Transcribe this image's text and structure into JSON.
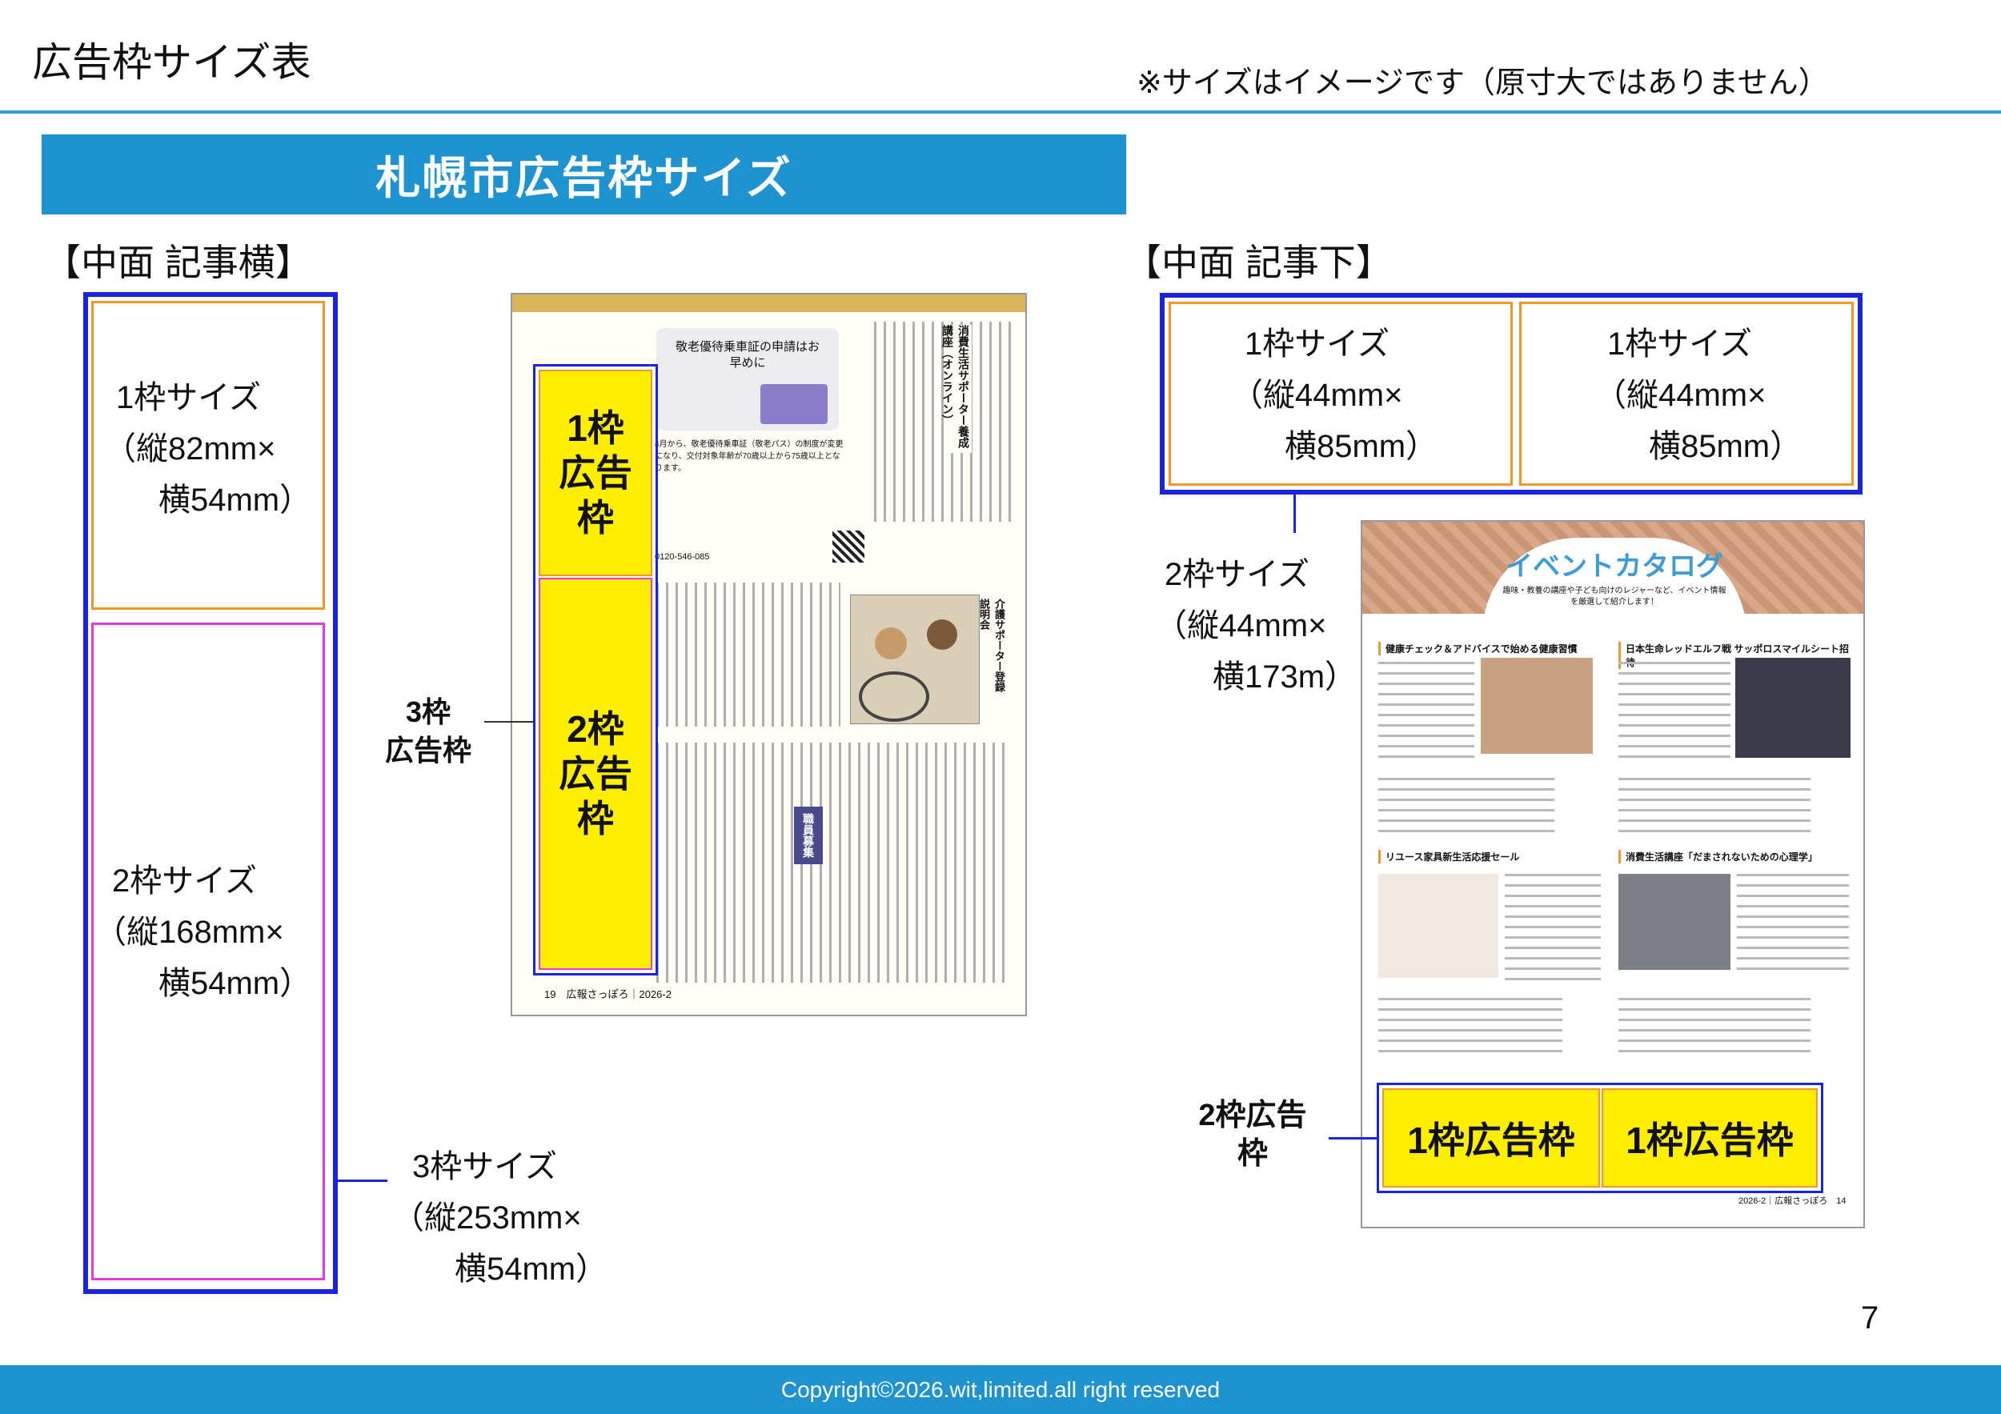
{
  "header": {
    "title": "広告枠サイズ表",
    "note": "※サイズはイメージです（原寸大ではありません）"
  },
  "banner": "札幌市広告枠サイズ",
  "left": {
    "heading": "【中面 記事横】",
    "box1": {
      "l1": "1枠サイズ",
      "l2": "（縦82mm×",
      "l3": "横54mm）"
    },
    "box2": {
      "l1": "2枠サイズ",
      "l2": "（縦168mm×",
      "l3": "横54mm）"
    },
    "box3": {
      "l1": "3枠サイズ",
      "l2": "（縦253mm×",
      "l3": "横54mm）"
    },
    "callout": {
      "l1": "3枠",
      "l2": "広告枠"
    },
    "ad1": {
      "l1": "1枠",
      "l2": "広告",
      "l3": "枠"
    },
    "ad2": {
      "l1": "2枠",
      "l2": "広告",
      "l3": "枠"
    },
    "doc": {
      "card_title": "敬老優待乗車証の申請はお早めに",
      "card_body": "4月から、敬老優待乗車証（敬老パス）の制度が変更になり、交付対象年齢が70歳以上から75歳以上となります。",
      "card_contact": "0120-546-085",
      "section1": "消費生活サポーター養成講座（オンライン）",
      "section2": "介護サポーター登録説明会",
      "section3": "職員募集",
      "footer": "19　広報さっぽろ｜2026-2"
    }
  },
  "right": {
    "heading": "【中面 記事下】",
    "box1": {
      "l1": "1枠サイズ",
      "l2": "（縦44mm×",
      "l3": "横85mm）"
    },
    "box2": {
      "l1": "1枠サイズ",
      "l2": "（縦44mm×",
      "l3": "横85mm）"
    },
    "box3": {
      "l1": "2枠サイズ",
      "l2": "（縦44mm×",
      "l3": "横173m）"
    },
    "callout": {
      "l1": "2枠広告",
      "l2": "枠"
    },
    "ad1": "1枠広告枠",
    "ad2": "1枠広告枠",
    "doc": {
      "title": "イベントカタログ",
      "subtitle": "趣味・教養の講座や子ども向けのレジャーなど、イベント情報を厳選して紹介します！",
      "ev1": "健康チェック＆アドバイスで始める健康習慣",
      "ev2": "日本生命レッドエルフ戦 サッポロスマイルシート招待",
      "ev3": "リユース家具新生活応援セール",
      "ev4": "消費生活講座「だまされないための心理学」",
      "footer": "2026-2｜広報さっぽろ　14"
    }
  },
  "page_number": "7",
  "copyright": "Copyright©2026.wit,limited.all right reserved",
  "colors": {
    "accent": "#1f93cf",
    "frame": "#1a23e0",
    "one_slot": "#f0962a",
    "two_slot": "#e83ad6",
    "ad": "#ffee00"
  }
}
